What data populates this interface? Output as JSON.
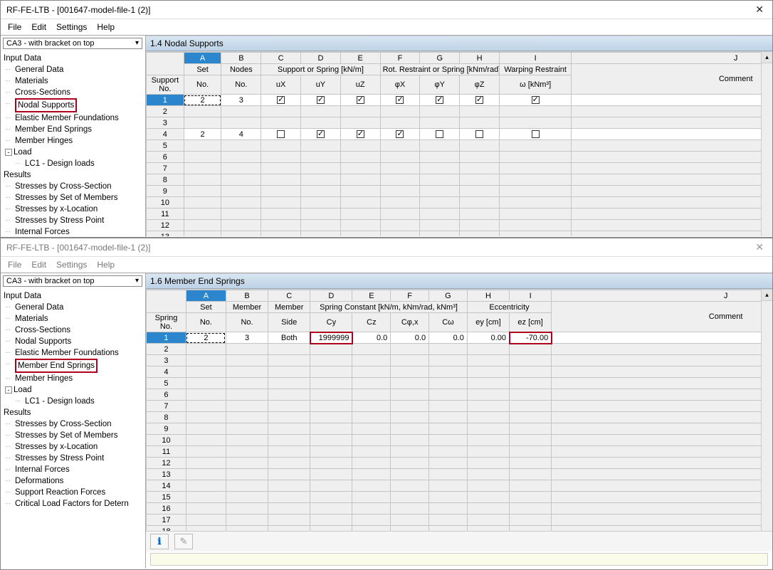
{
  "win1": {
    "title": "RF-FE-LTB - [001647-model-file-1 (2)]",
    "menu": [
      "File",
      "Edit",
      "Settings",
      "Help"
    ],
    "dropdown": "CA3 - with bracket on top",
    "tree": {
      "section1": "Input Data",
      "items1": [
        "General Data",
        "Materials",
        "Cross-Sections",
        "Nodal Supports",
        "Elastic Member Foundations",
        "Member End Springs",
        "Member Hinges"
      ],
      "highlighted1": "Nodal Supports",
      "load": "Load",
      "load_expander": "-",
      "load_sub": "LC1 - Design loads",
      "section2": "Results",
      "items2": [
        "Stresses by Cross-Section",
        "Stresses by Set of Members",
        "Stresses by x-Location",
        "Stresses by Stress Point",
        "Internal Forces"
      ]
    },
    "panelTitle": "1.4 Nodal Supports",
    "colLetters": [
      "A",
      "B",
      "C",
      "D",
      "E",
      "F",
      "G",
      "H",
      "I",
      "J"
    ],
    "group1": {
      "label": "Support",
      "sub": "No."
    },
    "headersTop": {
      "set": "Set",
      "nodes": "Nodes",
      "sos": "Support or Spring [kN/m]",
      "rrs": "Rot. Restraint or Spring [kNm/rad]",
      "warp": "Warping Restraint"
    },
    "headersBot": {
      "setno": "No.",
      "nodesno": "No.",
      "ux": "uX",
      "uy": "uY",
      "uz": "uZ",
      "phix": "φX",
      "phiy": "φY",
      "phiz": "φZ",
      "omega": "ω [kNm³]",
      "comment": "Comment"
    },
    "rows": [
      {
        "set": "2",
        "nodes": "3",
        "ux": true,
        "uy": true,
        "uz": true,
        "phix": true,
        "phiy": true,
        "phiz": true,
        "omega_chk": true
      },
      {},
      {},
      {
        "set": "2",
        "nodes": "4",
        "ux": false,
        "uy": true,
        "uz": true,
        "phix": true,
        "phiy": false,
        "phiz": false,
        "omega_chk": false
      }
    ],
    "rowCount": 13
  },
  "win2": {
    "title": "RF-FE-LTB - [001647-model-file-1 (2)]",
    "menu": [
      "File",
      "Edit",
      "Settings",
      "Help"
    ],
    "dropdown": "CA3 - with bracket on top",
    "tree": {
      "section1": "Input Data",
      "items1": [
        "General Data",
        "Materials",
        "Cross-Sections",
        "Nodal Supports",
        "Elastic Member Foundations",
        "Member End Springs",
        "Member Hinges"
      ],
      "highlighted1": "Member End Springs",
      "load": "Load",
      "load_expander": "-",
      "load_sub": "LC1 - Design loads",
      "section2": "Results",
      "items2": [
        "Stresses by Cross-Section",
        "Stresses by Set of Members",
        "Stresses by x-Location",
        "Stresses by Stress Point",
        "Internal Forces",
        "Deformations",
        "Support Reaction Forces",
        "Critical Load Factors for Detern"
      ]
    },
    "panelTitle": "1.6 Member End Springs",
    "colLetters": [
      "A",
      "B",
      "C",
      "D",
      "E",
      "F",
      "G",
      "H",
      "I",
      "J"
    ],
    "group1": {
      "label": "Spring",
      "sub": "No."
    },
    "headersTop": {
      "set": "Set",
      "member": "Member",
      "side": "Member",
      "sc": "Spring Constant [kN/m, kNm/rad, kNm³]",
      "ecc": "Eccentricity"
    },
    "headersBot": {
      "setno": "No.",
      "memberno": "No.",
      "side": "Side",
      "cy": "Cy",
      "cz": "Cz",
      "cphix": "Cφ,x",
      "cw": "Cω",
      "ey": "ey [cm]",
      "ez": "ez [cm]",
      "comment": "Comment"
    },
    "rows": [
      {
        "set": "2",
        "member": "3",
        "side": "Both",
        "cy": "1999999",
        "cz": "0.0",
        "cphix": "0.0",
        "cw": "0.0",
        "ey": "0.00",
        "ez": "-70.00"
      }
    ],
    "rowCount": 18,
    "infoIcon": "ℹ",
    "editIcon": "✎"
  }
}
